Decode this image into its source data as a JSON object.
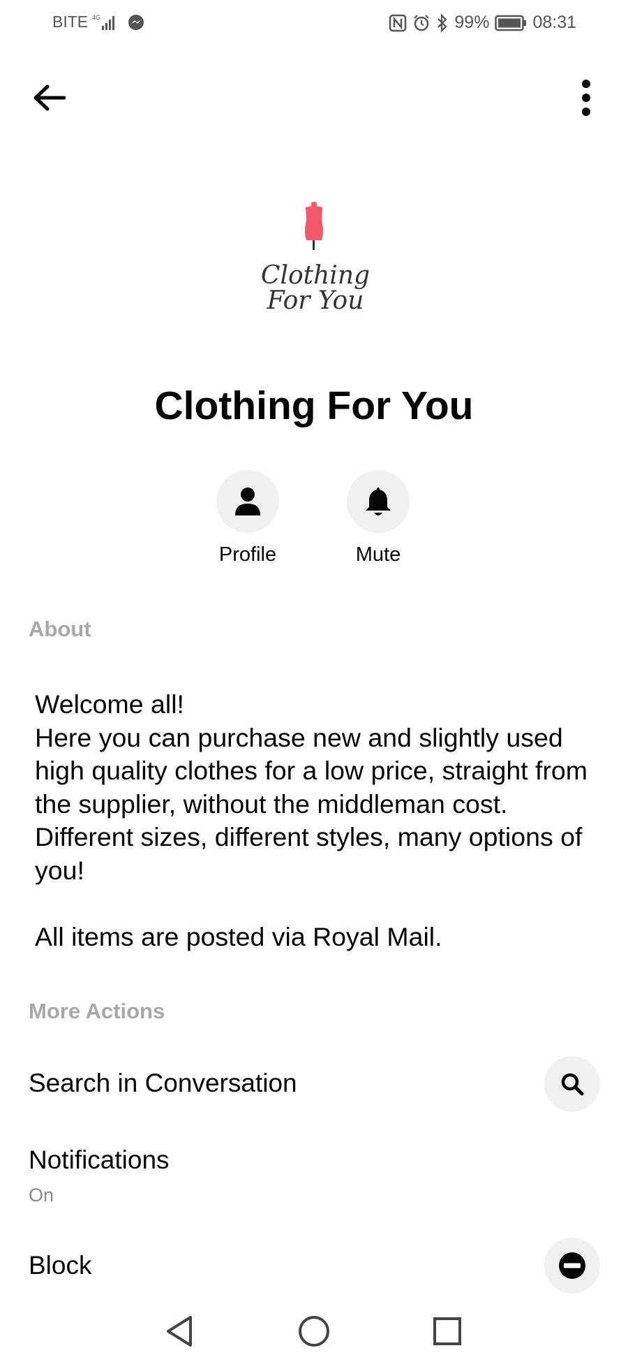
{
  "status_bar": {
    "carrier": "BITE",
    "network": "4G",
    "battery": "99%",
    "time": "08:31",
    "icons": [
      "signal-icon",
      "messenger-icon",
      "nfc-icon",
      "alarm-icon",
      "bluetooth-icon",
      "battery-icon"
    ]
  },
  "header": {
    "back_icon": "arrow-left-icon",
    "more_icon": "more-vertical-icon"
  },
  "avatar": {
    "logo_line1": "Clothing",
    "logo_line2": "For You",
    "logo_color": "#f2596b"
  },
  "page": {
    "name": "Clothing For You"
  },
  "actions": [
    {
      "label": "Profile",
      "icon": "person-icon"
    },
    {
      "label": "Mute",
      "icon": "bell-icon"
    }
  ],
  "about": {
    "header": "About",
    "text": "Welcome all!\nHere you can purchase new and slightly used high quality clothes for a low price, straight from the supplier, without the middleman cost. Different sizes, different styles, many options of you!\n\nAll items are posted via Royal Mail."
  },
  "more_actions": {
    "header": "More Actions",
    "search_label": "Search in Conversation",
    "notifications_label": "Notifications",
    "notifications_value": "On",
    "block_label": "Block"
  },
  "colors": {
    "header_gray": "#a8a8a8",
    "circle_bg": "#f0f0f0",
    "text": "#050505"
  }
}
